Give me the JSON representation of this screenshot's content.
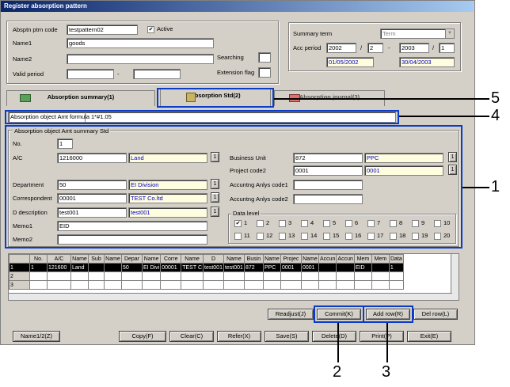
{
  "window": {
    "title": "Register absorption pattern"
  },
  "header": {
    "pattern_code_label": "Absptn ptrn code",
    "pattern_code_value": "testpattern02",
    "active_label": "Active",
    "active_checked": "✔",
    "name1_label": "Name1",
    "name1_value": "goods",
    "name2_label": "Name2",
    "name2_value": "",
    "valid_period_label": "Valid period",
    "valid_period_sep": "-",
    "searching_label": "Searching",
    "extension_flag_label": "Extension flag"
  },
  "summary_term": {
    "label": "Summary term",
    "term_value": "Term",
    "acc_period_label": "Acc period",
    "from_year": "2002",
    "from_month": "2",
    "sep1": "/",
    "dash": "-",
    "to_year": "2003",
    "sep2": "/",
    "to_month": "1",
    "from_date": "01/05/2002",
    "to_date": "30/04/2003"
  },
  "tabs": [
    {
      "label": "Absorption summary(1)"
    },
    {
      "label": "Absorption Std(2)"
    },
    {
      "label": "Absorption journal(3)"
    }
  ],
  "formula": {
    "label": "Absorption object Amt formula",
    "value": "1*#1.05"
  },
  "std": {
    "group_label": "Absorption object Amt summary Std",
    "no_label": "No.",
    "no_value": "1",
    "ac_label": "A/C",
    "ac_code": "1216000",
    "ac_name": "Land",
    "dept_label": "Department",
    "dept_code": "50",
    "dept_name": "EI Division",
    "corr_label": "Correspondent",
    "corr_code": "00001",
    "corr_name": "TEST Co.ltd",
    "ddesc_label": "D description",
    "ddesc_code": "test001",
    "ddesc_name": "test001",
    "memo1_label": "Memo1",
    "memo1_value": "EID",
    "memo2_label": "Memo2",
    "memo2_value": "",
    "bu_label": "Business Unit",
    "bu_code": "872",
    "bu_name": "PPC",
    "pc2_label": "Project code2",
    "pc2_code": "0001",
    "pc2_name": "0001",
    "aac1_label": "Accuntng Anlys code1",
    "aac2_label": "Accuntng Anlys code2",
    "lookup_btn": "1",
    "data_level_label": "Data level",
    "data_levels": [
      "1",
      "2",
      "3",
      "4",
      "5",
      "6",
      "7",
      "8",
      "9",
      "10",
      "11",
      "12",
      "13",
      "14",
      "15",
      "16",
      "17",
      "18",
      "19",
      "20"
    ],
    "checked_mark": "✔"
  },
  "grid": {
    "headers": [
      "",
      "No.",
      "A/C",
      "Name",
      "Sub",
      "Name",
      "Depar",
      "Name",
      "Corre",
      "Name",
      "D",
      "Name",
      "Busin",
      "Name",
      "Projec",
      "Name",
      "Accun",
      "Accun",
      "Mem",
      "Mem",
      "Data"
    ],
    "rows": [
      [
        "1",
        "1",
        "121600",
        "Land",
        "",
        "",
        "50",
        "EI Divi",
        "00001",
        "TEST C",
        "test001",
        "test001",
        "872",
        "PPC",
        "0001",
        "0001",
        "",
        "",
        "EID",
        "",
        "1"
      ],
      [
        "2",
        "",
        "",
        "",
        "",
        "",
        "",
        "",
        "",
        "",
        "",
        "",
        "",
        "",
        "",
        "",
        "",
        "",
        "",
        "",
        ""
      ],
      [
        "3",
        "",
        "",
        "",
        "",
        "",
        "",
        "",
        "",
        "",
        "",
        "",
        "",
        "",
        "",
        "",
        "",
        "",
        "",
        "",
        ""
      ]
    ]
  },
  "row_buttons": {
    "readjust": "Readjust(J)",
    "commit": "Commit(K)",
    "add_row": "Add row(R)",
    "del_row": "Del row(L)"
  },
  "bottom_buttons": {
    "name12": "Name1/2(Z)",
    "copy": "Copy(F)",
    "clear": "Clear(C)",
    "refer": "Refer(X)",
    "save": "Save(S)",
    "delete": "Delete(D)",
    "print": "Print(P)",
    "exit": "Exit(E)"
  },
  "callouts": {
    "c1": "1",
    "c2": "2",
    "c3": "3",
    "c4": "4",
    "c5": "5"
  },
  "colors": {
    "highlight_border": "#0a3cc8",
    "title_bar": "#0a246a",
    "lookup_field": "#fffde0"
  }
}
